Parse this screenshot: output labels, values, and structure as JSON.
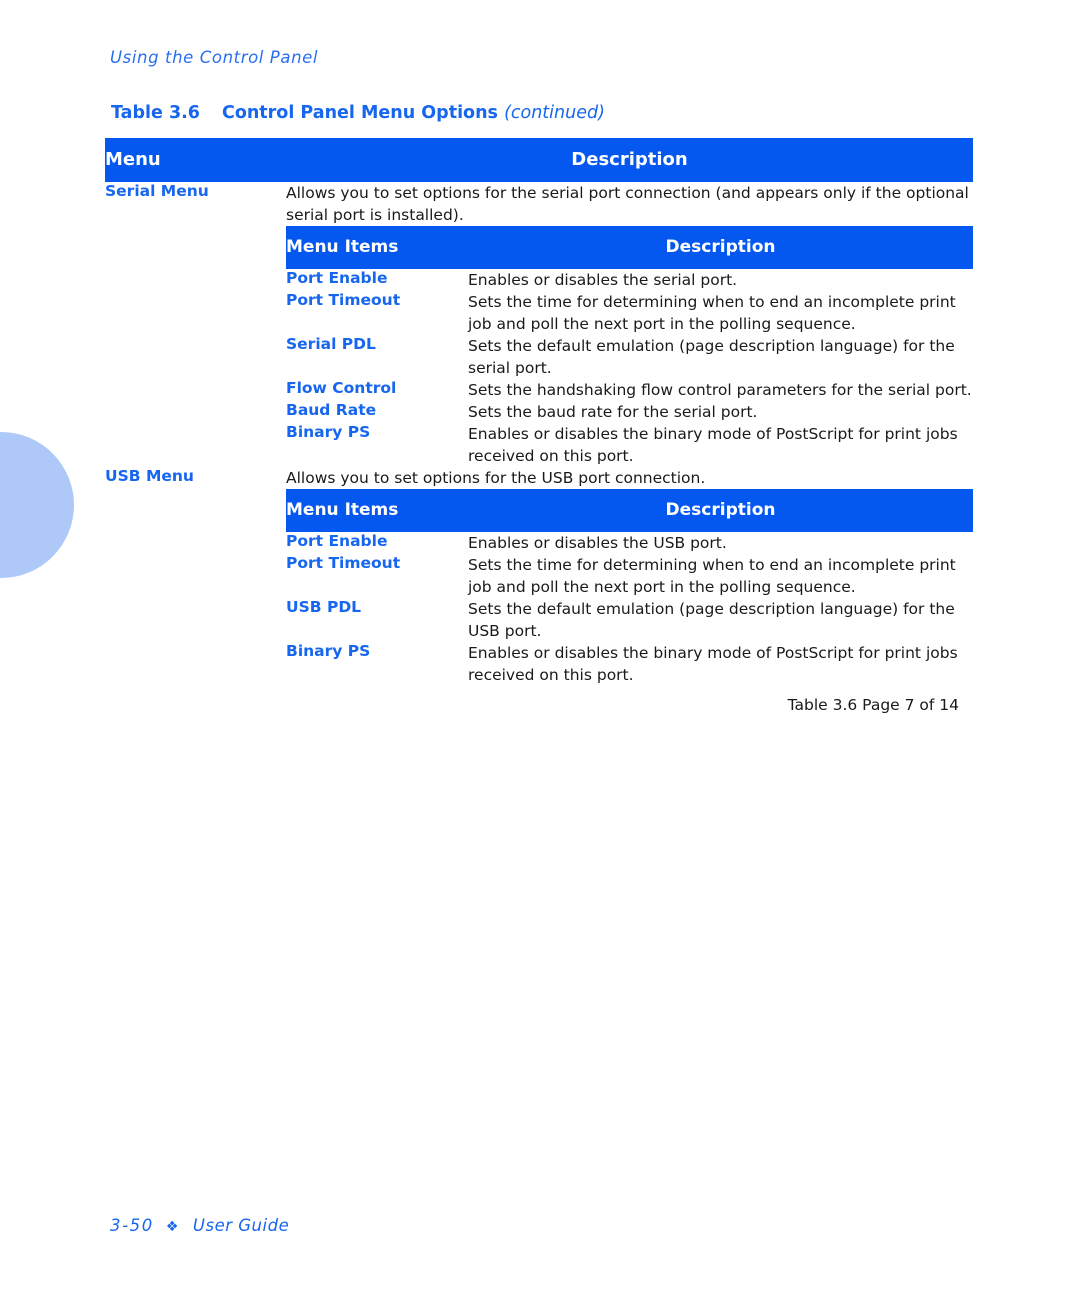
{
  "running_head": "Using the Control Panel",
  "caption": {
    "number": "Table 3.6",
    "title": "Control Panel Menu Options",
    "continued": "(continued)"
  },
  "colors": {
    "header_blue": "#0458f0",
    "link_blue": "#1766ef",
    "rule_blue": "#bcd6fb",
    "deco_blue": "#aec8f7"
  },
  "table": {
    "header": {
      "menu": "Menu",
      "description": "Description"
    },
    "sub_header": {
      "menu_items": "Menu Items",
      "description": "Description"
    },
    "sections": [
      {
        "menu": "Serial Menu",
        "description": "Allows you to set options for the serial port connection (and appears only if the optional serial port is installed).",
        "items": [
          {
            "name": "Port Enable",
            "description": "Enables or disables the serial port."
          },
          {
            "name": "Port Timeout",
            "description": "Sets the time for determining when to end an incomplete print job and poll the next port in the polling sequence."
          },
          {
            "name": "Serial PDL",
            "description": "Sets the default emulation (page description language) for the serial port."
          },
          {
            "name": "Flow Control",
            "description": "Sets the handshaking flow control parameters for the serial port."
          },
          {
            "name": "Baud Rate",
            "description": "Sets the baud rate for the serial port."
          },
          {
            "name": "Binary PS",
            "description": "Enables or disables the binary mode of PostScript for print jobs received on this port."
          }
        ]
      },
      {
        "menu": "USB Menu",
        "description": "Allows you to set options for the USB port connection.",
        "items": [
          {
            "name": "Port Enable",
            "description": "Enables or disables the USB port."
          },
          {
            "name": "Port Timeout",
            "description": "Sets the time for determining when to end an incomplete print job and poll the next port in the polling sequence."
          },
          {
            "name": "USB PDL",
            "description": "Sets the default emulation (page description language) for the USB port."
          },
          {
            "name": "Binary PS",
            "description": "Enables or disables the binary mode of PostScript for print jobs received on this port."
          }
        ]
      }
    ],
    "footer_note": "Table 3.6  Page 7 of 14"
  },
  "page_footer": {
    "page_number": "3-50",
    "bullet": "❖",
    "label": "User Guide"
  }
}
